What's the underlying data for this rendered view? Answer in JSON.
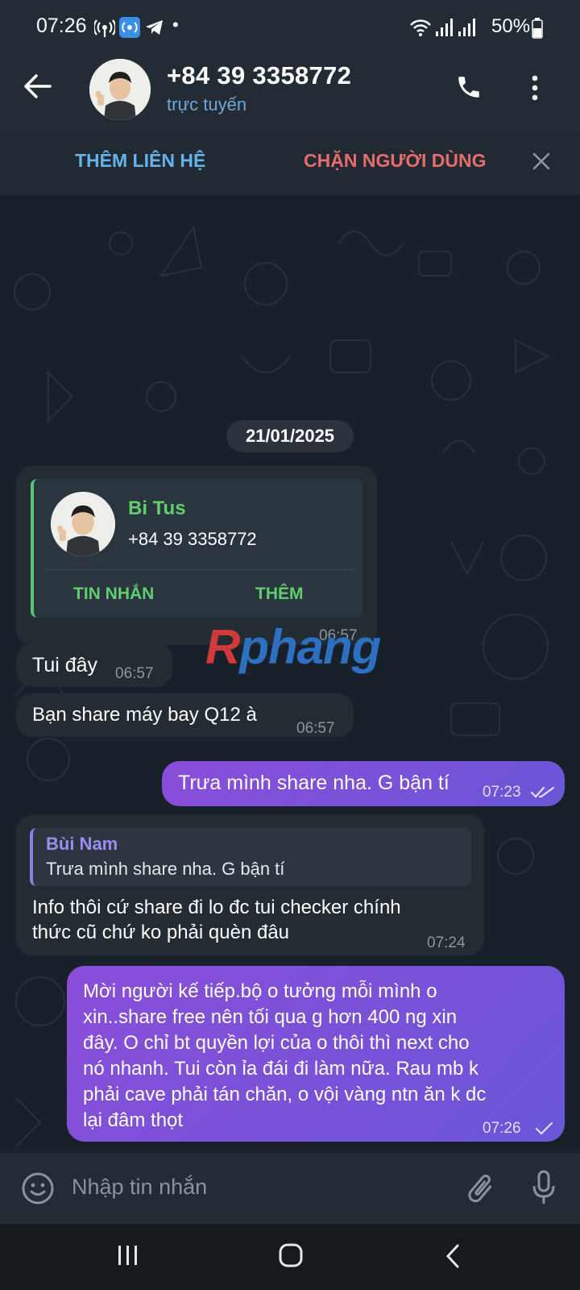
{
  "status_bar": {
    "time": "07:26",
    "dot": "•",
    "battery": "50%",
    "left_icons": [
      "hotspot-icon",
      "wifi-calling-icon",
      "telegram-icon"
    ],
    "right_icons": [
      "wifi-icon",
      "signal-icon",
      "signal-icon",
      "battery-icon"
    ]
  },
  "header": {
    "name": "+84 39 3358772",
    "status": "trực tuyến",
    "icons": [
      "back-arrow-icon",
      "phone-icon",
      "more-vert-icon"
    ]
  },
  "action_bar": {
    "add_contact": "THÊM LIÊN HỆ",
    "block_user": "CHẶN NGƯỜI DÙNG",
    "close_icon": "close-icon"
  },
  "chat": {
    "date": "21/01/2025",
    "contact_card": {
      "name": "Bi Tus",
      "phone": "+84 39 3358772",
      "message_button": "TIN NHẮN",
      "add_button": "THÊM",
      "time": "06:57"
    },
    "messages": [
      {
        "direction": "in",
        "text": "Tui đây",
        "time": "06:57"
      },
      {
        "direction": "in",
        "text": "Bạn share máy bay Q12 à",
        "time": "06:57"
      },
      {
        "direction": "out",
        "text": "Trưa mình share nha. G bận tí",
        "time": "07:23",
        "status": "read"
      },
      {
        "direction": "in",
        "reply_to": {
          "author": "Bùi Nam",
          "text": "Trưa mình share nha. G bận tí"
        },
        "lines": [
          "Info  thôi cứ share đi lo đc tui checker chính",
          "thức cũ chứ ko phải quèn đâu"
        ],
        "time": "07:24"
      },
      {
        "direction": "out",
        "lines": [
          "Mời người kế tiếp.bộ o tưởng mỗi mình o",
          "xin..share free nên tối qua g hơn 400 ng xin",
          "đây. O chỉ bt quyền lợi của o thôi thì next cho",
          "nó nhanh. Tui còn ỉa đái đi làm nữa. Rau mb k",
          "phải cave phải tán chăn, o vội vàng ntn ăn k dc",
          "lại đâm thọt"
        ],
        "time": "07:26",
        "status": "sent"
      }
    ]
  },
  "watermark": {
    "first": "R",
    "rest": "phang"
  },
  "input": {
    "placeholder": "Nhập tin nhắn",
    "icons": [
      "emoji-icon",
      "attach-icon",
      "mic-icon"
    ]
  },
  "nav_bar": {
    "icons": [
      "recent-apps-icon",
      "home-icon",
      "back-icon"
    ]
  },
  "colors": {
    "header_bg": "#232c35",
    "chat_bg": "#18202a",
    "incoming_bubble": "#232b33",
    "outgoing_bubble_start": "#8a4dd9",
    "outgoing_bubble_end": "#6a56d8",
    "accent_green": "#5fcf6d",
    "accent_blue": "#66b3ea",
    "accent_red": "#e96b6b"
  }
}
